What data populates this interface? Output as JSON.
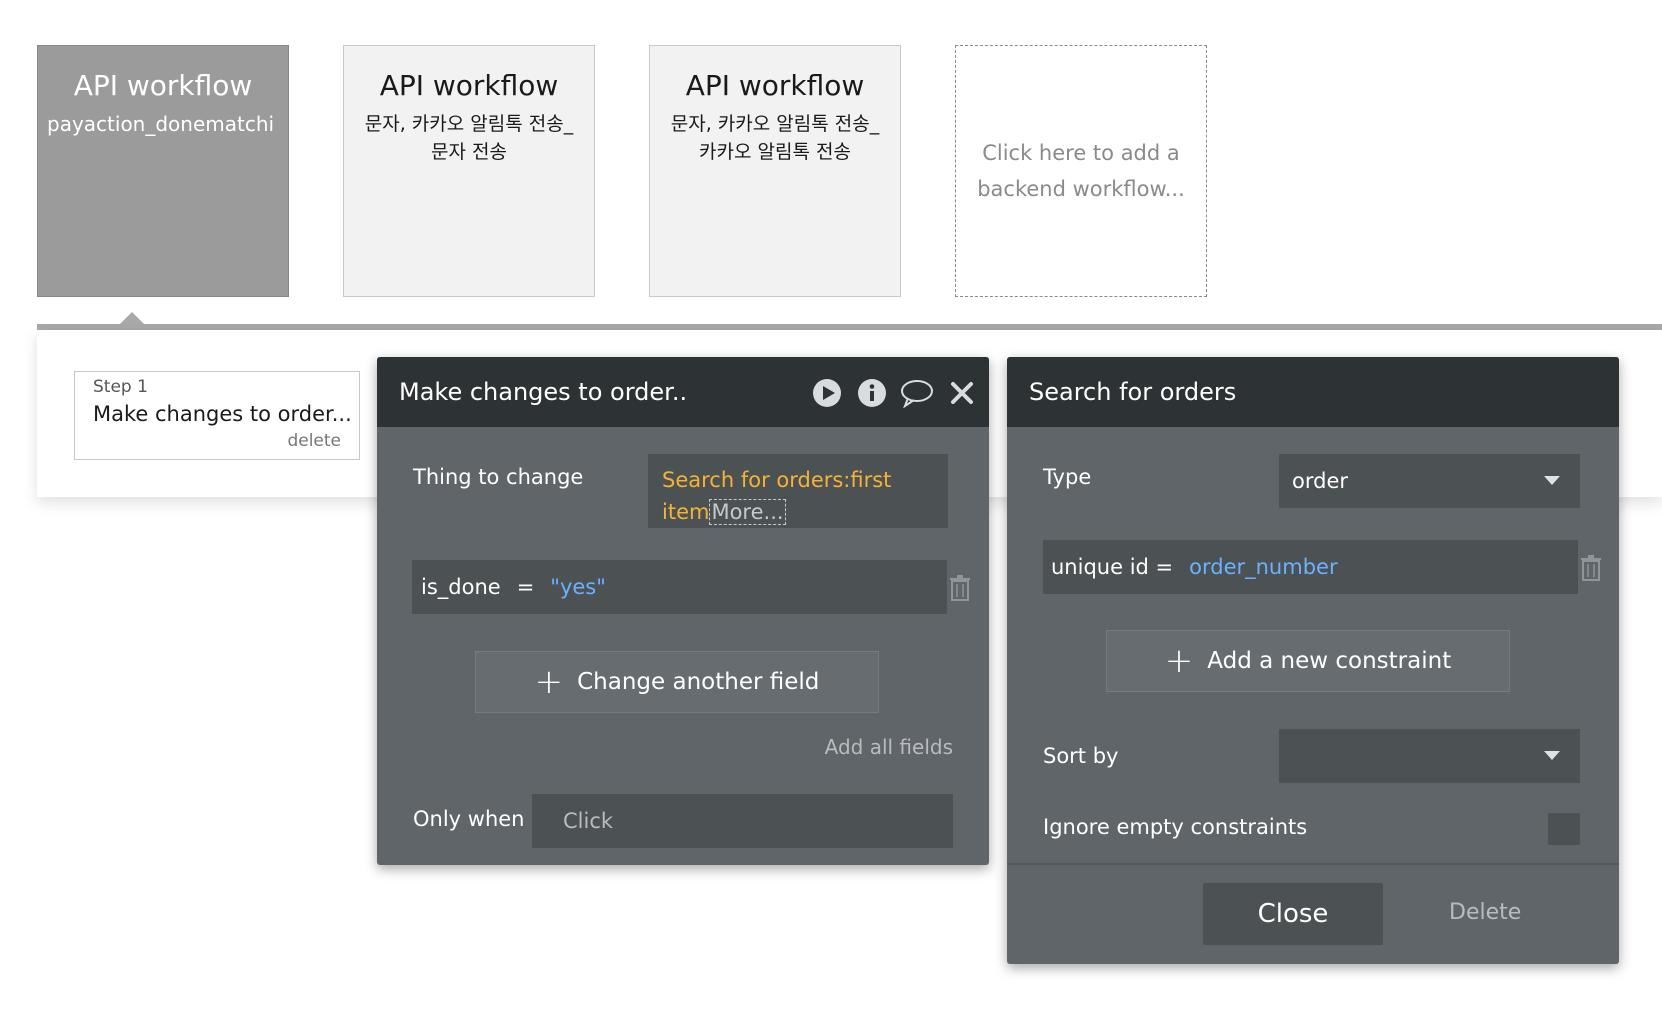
{
  "workflows": [
    {
      "title": "API workflow",
      "subtitle": "payaction_donematchi",
      "selected": true
    },
    {
      "title": "API workflow",
      "subtitle": "문자, 카카오 알림톡 전송_\n문자 전송",
      "selected": false
    },
    {
      "title": "API workflow",
      "subtitle": "문자, 카카오 알림톡 전송_\n카카오 알림톡 전송",
      "selected": false
    }
  ],
  "add_workflow_text": "Click here to add a backend workflow...",
  "step": {
    "number": "Step 1",
    "name": "Make changes to order...",
    "delete_label": "delete"
  },
  "make_changes_panel": {
    "title": "Make changes to order..",
    "icons": [
      "play-icon",
      "info-icon",
      "comment-icon",
      "close-icon"
    ],
    "thing_label": "Thing to change",
    "thing_value_line1": "Search for orders:first",
    "thing_value_line2": "item",
    "more_label": "More...",
    "field_name": "is_done",
    "field_eq": "=",
    "field_value": "\"yes\"",
    "change_another": "Change another field",
    "add_all_fields": "Add all fields",
    "only_when_label": "Only when",
    "only_when_placeholder": "Click"
  },
  "search_panel": {
    "title": "Search for orders",
    "type_label": "Type",
    "type_value": "order",
    "constraint_key": "unique id =",
    "constraint_value": "order_number",
    "add_constraint": "Add a new constraint",
    "sort_label": "Sort by",
    "sort_value": "",
    "ignore_label": "Ignore empty constraints",
    "close_label": "Close",
    "delete_label": "Delete"
  },
  "colors": {
    "accent_orange": "#f5b335",
    "accent_blue": "#6cb1ff",
    "panel_bg": "#5f6569",
    "panel_head": "#2d3235"
  }
}
